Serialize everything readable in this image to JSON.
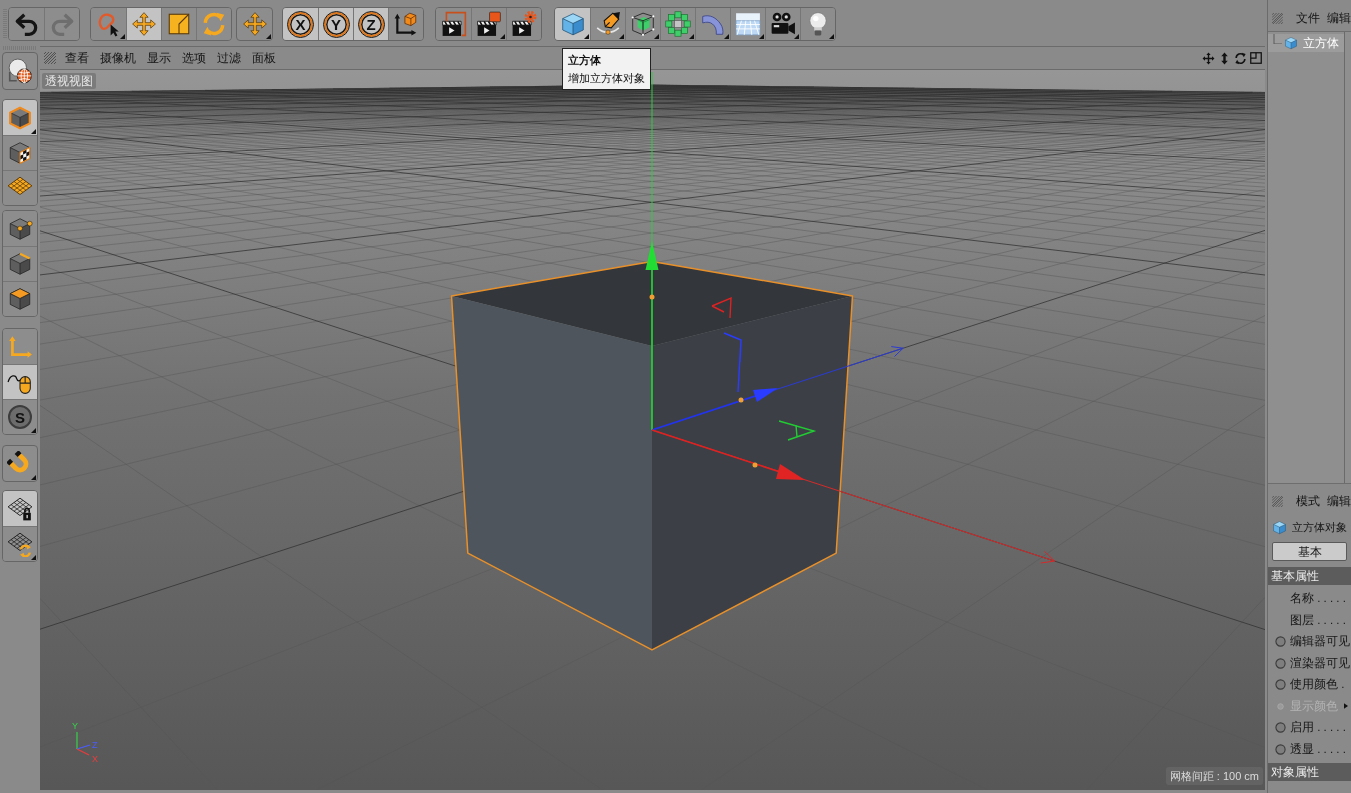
{
  "toolbar": [
    {
      "buttons": [
        {
          "kind": "undo",
          "selected": false,
          "disabled": false,
          "menu": false
        },
        {
          "kind": "redo",
          "selected": false,
          "disabled": true,
          "menu": false
        }
      ]
    },
    {
      "buttons": [
        {
          "kind": "select",
          "selected": false,
          "disabled": false,
          "menu": true
        },
        {
          "kind": "move",
          "selected": true,
          "disabled": false,
          "menu": false
        },
        {
          "kind": "scale",
          "selected": false,
          "disabled": false,
          "menu": false
        },
        {
          "kind": "rotate",
          "selected": false,
          "disabled": false,
          "menu": false
        }
      ]
    },
    {
      "buttons": [
        {
          "kind": "transform",
          "selected": false,
          "disabled": false,
          "menu": true
        }
      ]
    },
    {
      "buttons": [
        {
          "kind": "axis",
          "label": "X",
          "selected": true,
          "disabled": false,
          "menu": false
        },
        {
          "kind": "axis",
          "label": "Y",
          "selected": true,
          "disabled": false,
          "menu": false
        },
        {
          "kind": "axis",
          "label": "Z",
          "selected": true,
          "disabled": false,
          "menu": false
        },
        {
          "kind": "coordinates",
          "selected": false,
          "disabled": false,
          "menu": false
        }
      ]
    },
    {
      "buttons": [
        {
          "kind": "render_view",
          "selected": false,
          "disabled": false,
          "menu": false
        },
        {
          "kind": "render",
          "selected": false,
          "disabled": false,
          "menu": true
        },
        {
          "kind": "render_settings",
          "selected": false,
          "disabled": false,
          "menu": false
        }
      ]
    },
    {
      "buttons": [
        {
          "kind": "cube",
          "selected": true,
          "disabled": false,
          "menu": true
        },
        {
          "kind": "pen",
          "selected": false,
          "disabled": false,
          "menu": true
        },
        {
          "kind": "subdivision",
          "selected": false,
          "disabled": false,
          "menu": true
        },
        {
          "kind": "cloner",
          "selected": false,
          "disabled": false,
          "menu": true
        },
        {
          "kind": "bend",
          "selected": false,
          "disabled": false,
          "menu": true
        },
        {
          "kind": "floor",
          "selected": false,
          "disabled": false,
          "menu": true
        },
        {
          "kind": "camera",
          "selected": false,
          "disabled": false,
          "menu": true
        },
        {
          "kind": "light",
          "selected": false,
          "disabled": false,
          "menu": true
        }
      ]
    }
  ],
  "tooltip": {
    "title": "立方体",
    "description": "增加立方体对象"
  },
  "mode_bar": [
    {
      "buttons": [
        {
          "kind": "make_editable",
          "selected": false,
          "menu": false
        }
      ]
    },
    {
      "buttons": [
        {
          "kind": "model",
          "selected": true,
          "menu": true
        },
        {
          "kind": "texture",
          "selected": false,
          "menu": false
        },
        {
          "kind": "workplane",
          "selected": false,
          "menu": false
        }
      ]
    },
    {
      "buttons": [
        {
          "kind": "points",
          "selected": false,
          "menu": false
        },
        {
          "kind": "edges",
          "selected": false,
          "menu": false
        },
        {
          "kind": "polygons",
          "selected": false,
          "menu": false
        }
      ]
    },
    {
      "buttons": [
        {
          "kind": "axis_mode",
          "selected": false,
          "menu": false
        },
        {
          "kind": "tweak",
          "selected": true,
          "menu": false
        },
        {
          "kind": "snap",
          "label": "S",
          "selected": false,
          "menu": true
        }
      ]
    },
    {
      "buttons": [
        {
          "kind": "magnet",
          "selected": false,
          "menu": true
        }
      ]
    },
    {
      "buttons": [
        {
          "kind": "lock_workplane",
          "selected": true,
          "menu": false
        },
        {
          "kind": "workplane_align",
          "selected": false,
          "menu": true
        }
      ]
    }
  ],
  "viewport": {
    "menu": [
      "查看",
      "摄像机",
      "显示",
      "选项",
      "过滤",
      "面板"
    ],
    "label": "透视视图",
    "axis_labels": [
      "Y",
      "Z",
      "X"
    ],
    "grid_spacing": "网格间距 : 100 cm"
  },
  "object_manager": {
    "menu": [
      "文件",
      "编辑"
    ],
    "objects": [
      {
        "name": "立方体",
        "selected": true
      }
    ]
  },
  "attribute_manager": {
    "menu": [
      "模式",
      "编辑"
    ],
    "title": "立方体对象",
    "tabs": [
      {
        "label": "基本",
        "selected": true
      }
    ],
    "sections": [
      {
        "title": "基本属性",
        "rows": [
          {
            "kind": "field",
            "label": "名称 . . . . .",
            "disabled": false
          },
          {
            "kind": "field",
            "label": "图层 . . . . .",
            "disabled": false
          },
          {
            "kind": "param",
            "label": "编辑器可见",
            "disabled": false
          },
          {
            "kind": "param",
            "label": "渲染器可见",
            "disabled": false
          },
          {
            "kind": "param",
            "label": "使用颜色 .",
            "disabled": false
          },
          {
            "kind": "group",
            "label": "显示颜色",
            "disabled": true
          },
          {
            "kind": "param",
            "label": "启用 . . . . .",
            "disabled": false
          },
          {
            "kind": "param",
            "label": "透显 . . . . .",
            "disabled": false
          }
        ]
      },
      {
        "title": "对象属性"
      }
    ]
  }
}
